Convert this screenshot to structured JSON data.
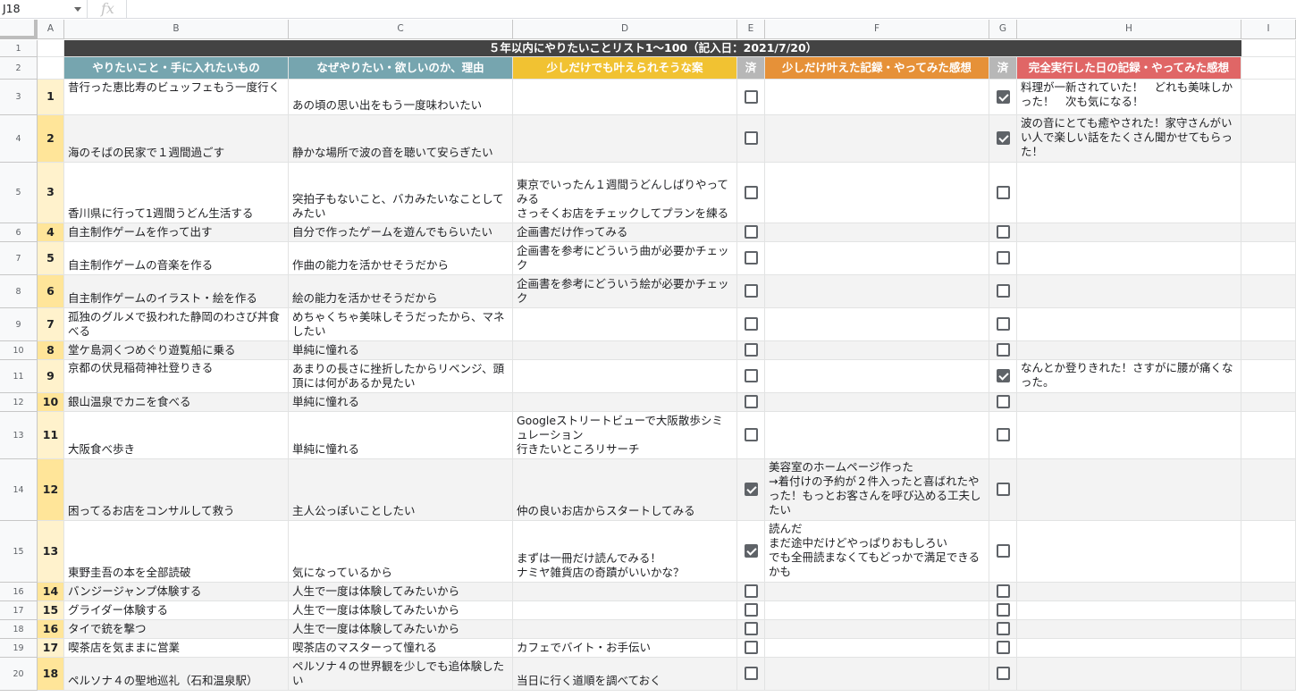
{
  "namebox": "J18",
  "fx": "fx",
  "columns": [
    "A",
    "B",
    "C",
    "D",
    "E",
    "F",
    "G",
    "H",
    "I"
  ],
  "title": "５年以内にやりたいことリスト1〜100（記入日：2021/7/20）",
  "headers": {
    "b": "やりたいこと・手に入れたいもの",
    "c": "なぜやりたい・欲しいのか、理由",
    "d": "少しだけでも叶えられそうな案",
    "e": "済",
    "f": "少しだけ叶えた記録・やってみた感想",
    "g": "済",
    "h": "完全実行した日の記録・やってみた感想"
  },
  "header_colors": {
    "b": "#76a5af",
    "c": "#76a5af",
    "d": "#f1c232",
    "e": "#b7b7b7",
    "f": "#e69138",
    "g": "#b7b7b7",
    "h": "#e06666"
  },
  "row_numbers": [
    "1",
    "2",
    "3",
    "4",
    "5",
    "6",
    "7",
    "8",
    "9",
    "10",
    "11",
    "12",
    "13",
    "14",
    "15",
    "16",
    "17",
    "18",
    "19",
    "20"
  ],
  "rows": [
    {
      "n": "1",
      "b": "昔行った恵比寿のビュッフェもう一度行く",
      "c": "あの頃の思い出をもう一度味わいたい",
      "d": "",
      "e": false,
      "f": "",
      "g": true,
      "h": "料理が一新されていた！　どれも美味しかった！　次も気になる！"
    },
    {
      "n": "2",
      "b": "海のそばの民家で１週間過ごす",
      "c": "静かな場所で波の音を聴いて安らぎたい",
      "d": "",
      "e": false,
      "f": "",
      "g": true,
      "h": "波の音にとても癒やされた！家守さんがいい人で楽しい話をたくさん聞かせてもらった！"
    },
    {
      "n": "3",
      "b": "香川県に行って1週間うどん生活する",
      "c": "突拍子もないこと、バカみたいなことしてみたい",
      "d": "東京でいったん１週間うどんしばりやってみる\nさっそくお店をチェックしてプランを練る",
      "e": false,
      "f": "",
      "g": false,
      "h": ""
    },
    {
      "n": "4",
      "b": "自主制作ゲームを作って出す",
      "c": "自分で作ったゲームを遊んでもらいたい",
      "d": "企画書だけ作ってみる",
      "e": false,
      "f": "",
      "g": false,
      "h": ""
    },
    {
      "n": "5",
      "b": "自主制作ゲームの音楽を作る",
      "c": "作曲の能力を活かせそうだから",
      "d": "企画書を参考にどういう曲が必要かチェック",
      "e": false,
      "f": "",
      "g": false,
      "h": ""
    },
    {
      "n": "6",
      "b": "自主制作ゲームのイラスト・絵を作る",
      "c": "絵の能力を活かせそうだから",
      "d": "企画書を参考にどういう絵が必要かチェック",
      "e": false,
      "f": "",
      "g": false,
      "h": ""
    },
    {
      "n": "7",
      "b": "孤独のグルメで扱われた静岡のわさび丼食べる",
      "c": "めちゃくちゃ美味しそうだったから、マネしたい",
      "d": "",
      "e": false,
      "f": "",
      "g": false,
      "h": ""
    },
    {
      "n": "8",
      "b": "堂ケ島洞くつめぐり遊覧船に乗る",
      "c": "単純に憧れる",
      "d": "",
      "e": false,
      "f": "",
      "g": false,
      "h": ""
    },
    {
      "n": "9",
      "b": "京都の伏見稲荷神社登りきる",
      "c": "あまりの長さに挫折したからリベンジ、頭頂には何があるか見たい",
      "d": "",
      "e": false,
      "f": "",
      "g": true,
      "h": "なんとか登りきれた！さすがに腰が痛くなった。"
    },
    {
      "n": "10",
      "b": "銀山温泉でカニを食べる",
      "c": "単純に憧れる",
      "d": "",
      "e": false,
      "f": "",
      "g": false,
      "h": ""
    },
    {
      "n": "11",
      "b": "大阪食べ歩き",
      "c": "単純に憧れる",
      "d": "Googleストリートビューで大阪散歩シミュレーション\n行きたいところリサーチ",
      "e": false,
      "f": "",
      "g": false,
      "h": ""
    },
    {
      "n": "12",
      "b": "困ってるお店をコンサルして救う",
      "c": "主人公っぽいことしたい",
      "d": "仲の良いお店からスタートしてみる",
      "e": true,
      "f": "美容室のホームページ作った\n→着付けの予約が２件入ったと喜ばれたやった！もっとお客さんを呼び込める工夫したい",
      "g": false,
      "h": ""
    },
    {
      "n": "13",
      "b": "東野圭吾の本を全部読破",
      "c": "気になっているから",
      "d": "まずは一冊だけ読んでみる！\nナミヤ雑貨店の奇蹟がいいかな？",
      "e": true,
      "f": "読んだ\nまだ途中だけどやっぱりおもしろい\nでも全冊読まなくてもどっかで満足できるかも",
      "g": false,
      "h": ""
    },
    {
      "n": "14",
      "b": "バンジージャンプ体験する",
      "c": "人生で一度は体験してみたいから",
      "d": "",
      "e": false,
      "f": "",
      "g": false,
      "h": ""
    },
    {
      "n": "15",
      "b": "グライダー体験する",
      "c": "人生で一度は体験してみたいから",
      "d": "",
      "e": false,
      "f": "",
      "g": false,
      "h": ""
    },
    {
      "n": "16",
      "b": "タイで銃を撃つ",
      "c": "人生で一度は体験してみたいから",
      "d": "",
      "e": false,
      "f": "",
      "g": false,
      "h": ""
    },
    {
      "n": "17",
      "b": "喫茶店を気ままに営業",
      "c": "喫茶店のマスターって憧れる",
      "d": "カフェでバイト・お手伝い",
      "e": false,
      "f": "",
      "g": false,
      "h": ""
    },
    {
      "n": "18",
      "b": "ペルソナ４の聖地巡礼（石和温泉駅）",
      "c": "ペルソナ４の世界観を少しでも追体験したい",
      "d": "当日に行く道順を調べておく",
      "e": false,
      "f": "",
      "g": false,
      "h": ""
    }
  ]
}
